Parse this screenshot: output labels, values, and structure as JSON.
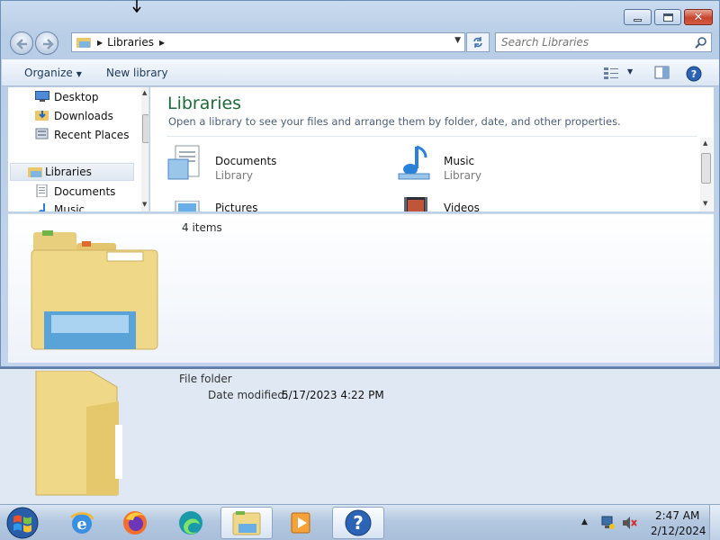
{
  "address": {
    "crumb": "Libraries"
  },
  "search": {
    "placeholder": "Search Libraries"
  },
  "toolbar": {
    "organize": "Organize",
    "new_library": "New library"
  },
  "nav": {
    "items": [
      {
        "label": "Desktop",
        "icon": "desktop-icon"
      },
      {
        "label": "Downloads",
        "icon": "downloads-icon"
      },
      {
        "label": "Recent Places",
        "icon": "recent-places-icon"
      },
      {
        "label": "Libraries",
        "icon": "libraries-icon",
        "selected": true
      },
      {
        "label": "Documents",
        "icon": "documents-icon"
      },
      {
        "label": "Music",
        "icon": "music-icon"
      }
    ]
  },
  "main": {
    "title": "Libraries",
    "description": "Open a library to see your files and arrange them by folder, date, and other properties.",
    "libraries": [
      {
        "name": "Documents",
        "type": "Library"
      },
      {
        "name": "Music",
        "type": "Library"
      },
      {
        "name": "Pictures"
      },
      {
        "name": "Videos"
      }
    ]
  },
  "details": {
    "count": "4 items"
  },
  "lower": {
    "type": "File folder",
    "date_label": "Date modified:",
    "date_value": "5/17/2023 4:22 PM"
  },
  "taskbar": {
    "apps": [
      "internet-explorer-icon",
      "firefox-icon",
      "edge-icon",
      "explorer-icon",
      "media-player-icon",
      "help-icon"
    ],
    "time": "2:47 AM",
    "date": "2/12/2024"
  },
  "colors": {
    "accent_title": "#1e6b39",
    "close_button": "#c8452e"
  }
}
